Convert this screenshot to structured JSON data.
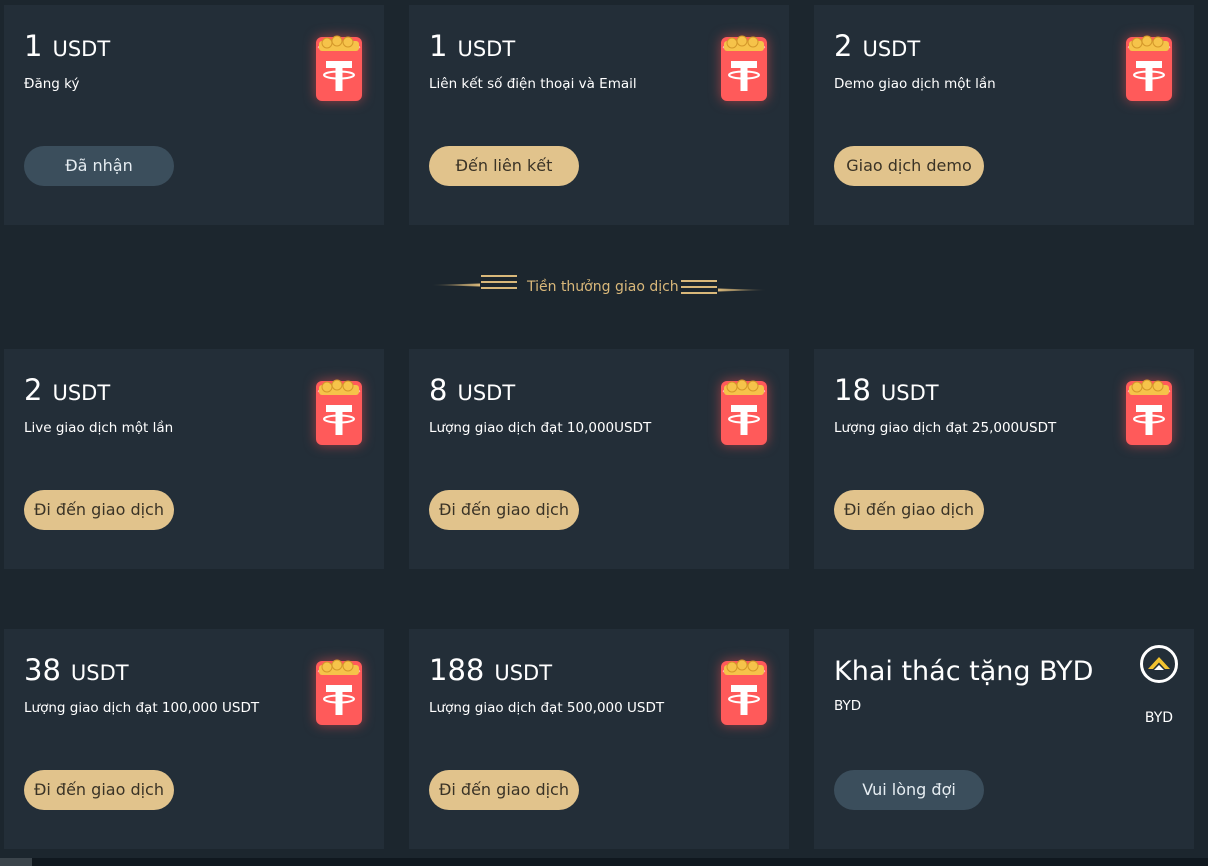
{
  "colors": {
    "background": "#1c262e",
    "card": "#232e38",
    "gold_button": "#e1c38c",
    "dark_button": "#3b4e5c",
    "tether_red": "#ff5a5a",
    "section_title": "#d9b87a"
  },
  "section": {
    "title": "Tiền thưởng giao dịch"
  },
  "cards": [
    {
      "amount": "1",
      "unit": "USDT",
      "desc": "Đăng ký",
      "button": "Đã nhận",
      "icon": "tether-red-packet-icon"
    },
    {
      "amount": "1",
      "unit": "USDT",
      "desc": "Liên kết số điện thoại và Email",
      "button": "Đến liên kết",
      "icon": "tether-red-packet-icon"
    },
    {
      "amount": "2",
      "unit": "USDT",
      "desc": "Demo giao dịch một lần",
      "button": "Giao dịch demo",
      "icon": "tether-red-packet-icon"
    },
    {
      "amount": "2",
      "unit": "USDT",
      "desc": "Live giao dịch một lần",
      "button": "Đi đến giao dịch",
      "icon": "tether-red-packet-icon"
    },
    {
      "amount": "8",
      "unit": "USDT",
      "desc": "Lượng giao dịch đạt 10,000USDT",
      "button": "Đi đến giao dịch",
      "icon": "tether-red-packet-icon"
    },
    {
      "amount": "18",
      "unit": "USDT",
      "desc": "Lượng giao dịch đạt 25,000USDT",
      "button": "Đi đến giao dịch",
      "icon": "tether-red-packet-icon"
    },
    {
      "amount": "38",
      "unit": "USDT",
      "desc": "Lượng giao dịch đạt 100,000 USDT",
      "button": "Đi đến giao dịch",
      "icon": "tether-red-packet-icon"
    },
    {
      "amount": "188",
      "unit": "USDT",
      "desc": "Lượng giao dịch đạt 500,000 USDT",
      "button": "Đi đến giao dịch",
      "icon": "tether-red-packet-icon"
    },
    {
      "title": "Khai thác tặng BYD",
      "desc": "BYD",
      "button": "Vui lòng đợi",
      "icon": "byd-logo-icon",
      "icon_label": "BYD"
    }
  ]
}
